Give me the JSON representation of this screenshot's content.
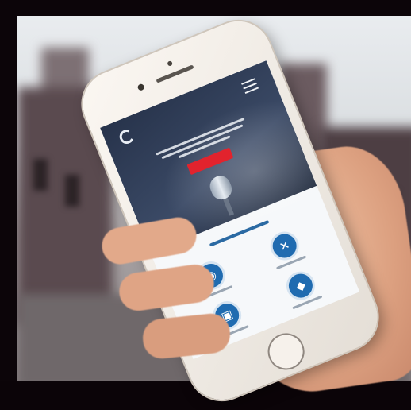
{
  "scene": "photo",
  "phone_ui": {
    "hero_button_color": "#e2232d",
    "accent_color": "#1f6bb0",
    "services": [
      {
        "icon": "globe-icon",
        "glyph": "◉"
      },
      {
        "icon": "tools-icon",
        "glyph": "✕"
      },
      {
        "icon": "shop-icon",
        "glyph": "▣"
      },
      {
        "icon": "graduation-cap-icon",
        "glyph": "◆"
      }
    ]
  }
}
